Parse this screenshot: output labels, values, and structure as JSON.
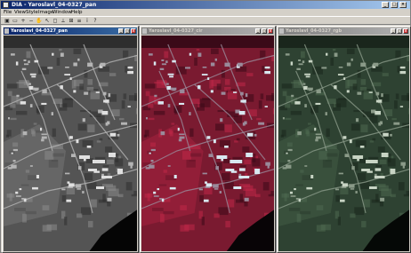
{
  "window": {
    "title": "DIA - Yaroslavl_04-0327_pan",
    "minimize_glyph": "_",
    "maximize_glyph": "□",
    "close_glyph": "×"
  },
  "menu": [
    "File",
    "View",
    "Style",
    "Image",
    "Window",
    "Help"
  ],
  "toolbar": {
    "icons": [
      "open-icon",
      "save-icon",
      "zoom-in-icon",
      "zoom-out-icon",
      "hand-icon",
      "select-icon",
      "roi-icon",
      "measure-icon",
      "grid-icon",
      "layers-icon",
      "info-icon",
      "help-icon"
    ],
    "glyphs": [
      "▣",
      "▭",
      "+",
      "−",
      "✋",
      "↖",
      "◻",
      "⟂",
      "⊞",
      "≡",
      "i",
      "?"
    ]
  },
  "panels": [
    {
      "title": "Yaroslavl_04-0327_pan",
      "active": true,
      "palette": "pan"
    },
    {
      "title": "Yaroslavl_04-0327_cir",
      "active": false,
      "palette": "cir"
    },
    {
      "title": "Yaroslavl_04-0327_rgb",
      "active": false,
      "palette": "rgb"
    }
  ],
  "colors": {
    "pan": {
      "water": "#050505",
      "ground": "#545454",
      "dark": "#2e2e2e",
      "light": "#8a8a8a",
      "road": "#b4b4b4",
      "bright": "#e0e0e0"
    },
    "cir": {
      "water": "#080406",
      "ground": "#7a1a30",
      "dark": "#3a0a18",
      "light": "#c02848",
      "road": "#9a8a9a",
      "bright": "#d8e8f0"
    },
    "rgb": {
      "water": "#050806",
      "ground": "#2e4232",
      "dark": "#1a261c",
      "light": "#4e6a50",
      "road": "#8a9a88",
      "bright": "#c8d4c4"
    }
  }
}
